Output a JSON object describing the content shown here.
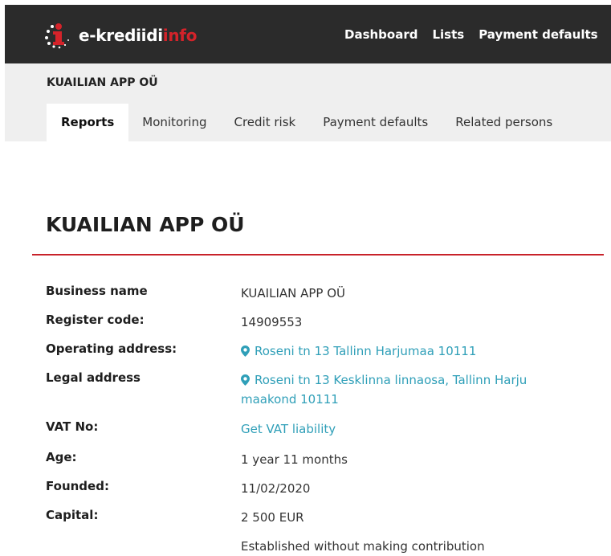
{
  "brand": {
    "name_white": "e-krediidi",
    "name_red": "info",
    "colors": {
      "topbar": "#2b2b2b",
      "accent": "#d4232a",
      "link": "#2f9fb8",
      "subbar": "#efefef"
    }
  },
  "topnav": [
    "Dashboard",
    "Lists",
    "Payment defaults"
  ],
  "company_header": "KUAILIAN APP OÜ",
  "tabs": [
    {
      "label": "Reports",
      "active": true
    },
    {
      "label": "Monitoring",
      "active": false
    },
    {
      "label": "Credit risk",
      "active": false
    },
    {
      "label": "Payment defaults",
      "active": false
    },
    {
      "label": "Related persons",
      "active": false
    }
  ],
  "page_title": "KUAILIAN APP OÜ",
  "details": {
    "business_name": {
      "label": "Business name",
      "value": "KUAILIAN APP OÜ"
    },
    "register_code": {
      "label": "Register code:",
      "value": "14909553"
    },
    "operating_address": {
      "label": "Operating address:",
      "value": "Roseni tn 13 Tallinn Harjumaa 10111",
      "icon": "map-pin-icon"
    },
    "legal_address": {
      "label": "Legal address",
      "value": "Roseni tn 13 Kesklinna linnaosa, Tallinn Harju maakond 10111",
      "icon": "map-pin-icon"
    },
    "vat_no": {
      "label": "VAT No:",
      "value": "Get VAT liability"
    },
    "age": {
      "label": "Age:",
      "value": "1 year 11 months"
    },
    "founded": {
      "label": "Founded:",
      "value": "11/02/2020"
    },
    "capital": {
      "label": "Capital:",
      "value": "2 500 EUR",
      "note": "Established without making contribution"
    }
  }
}
